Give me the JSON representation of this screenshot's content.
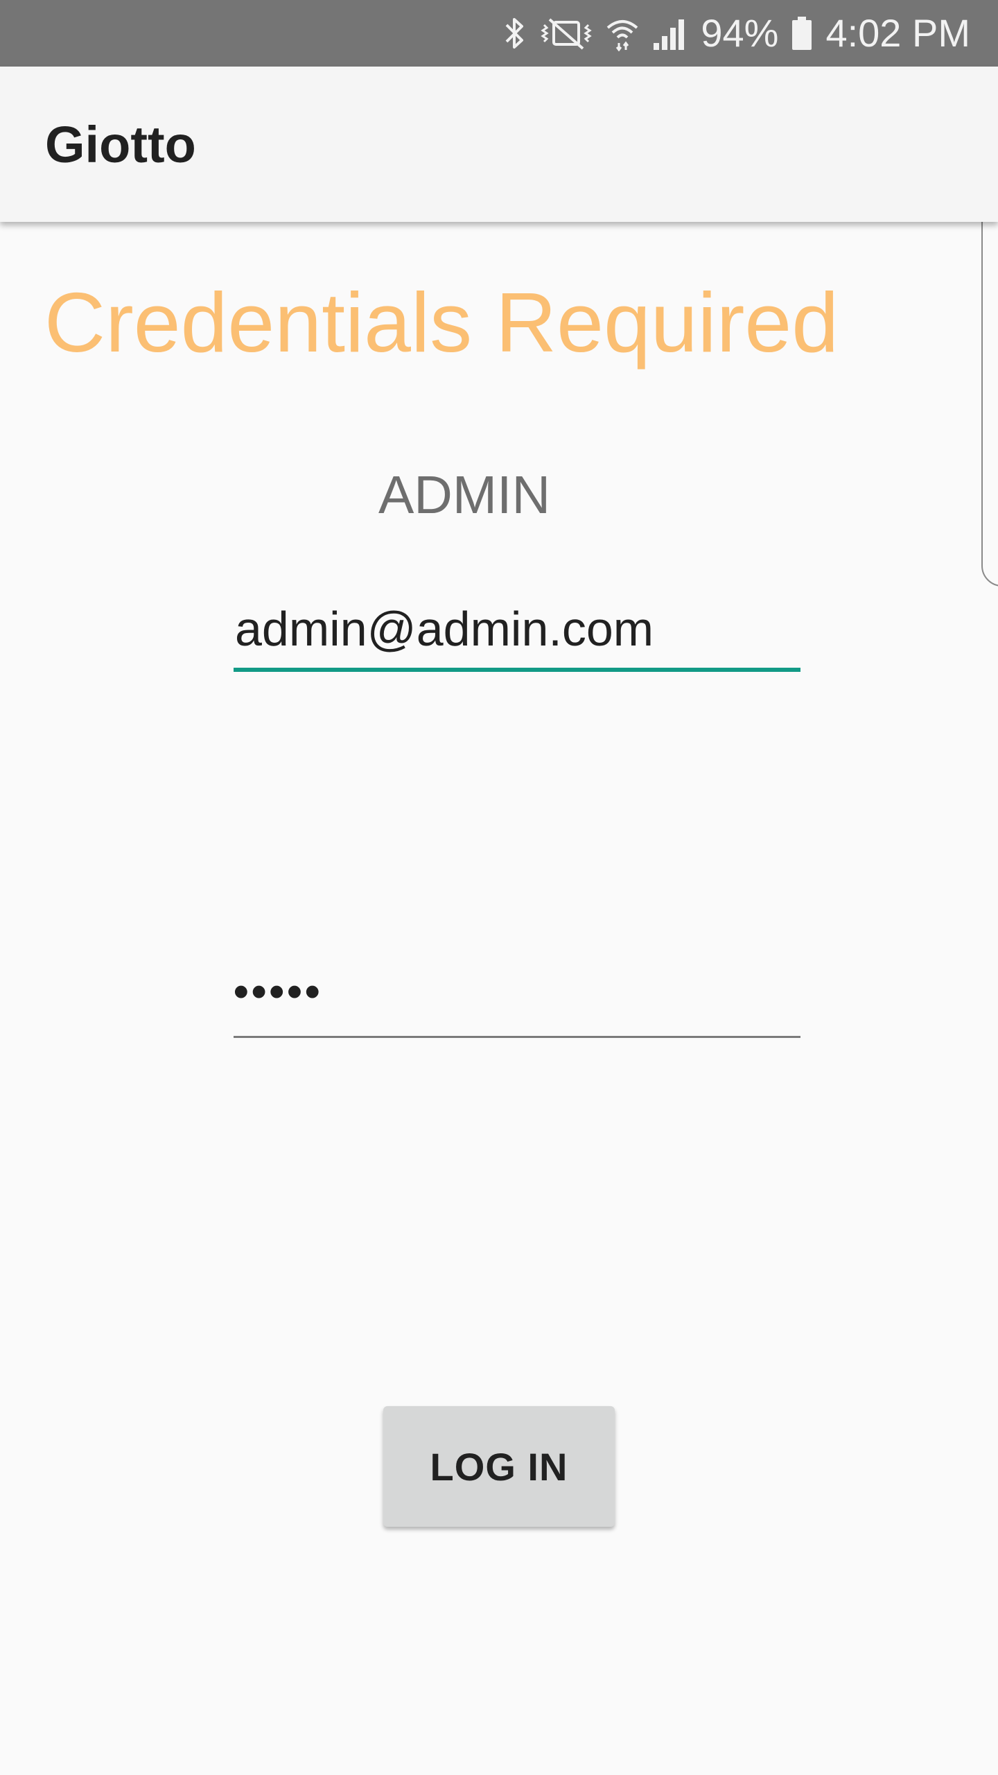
{
  "status_bar": {
    "battery_percent": "94%",
    "time": "4:02 PM",
    "icons": [
      "bluetooth-icon",
      "vibrate-mute-icon",
      "wifi-icon",
      "signal-icon",
      "battery-icon"
    ]
  },
  "app_bar": {
    "title": "Giotto"
  },
  "screen": {
    "heading": "Credentials Required",
    "role_label": "ADMIN",
    "email_value": "admin@admin.com",
    "password_value": "•••••",
    "login_label": "LOG IN"
  },
  "colors": {
    "heading": "#fbbf73",
    "field_focus": "#129a86",
    "status_bar": "#757575",
    "button": "#d6d7d7"
  }
}
